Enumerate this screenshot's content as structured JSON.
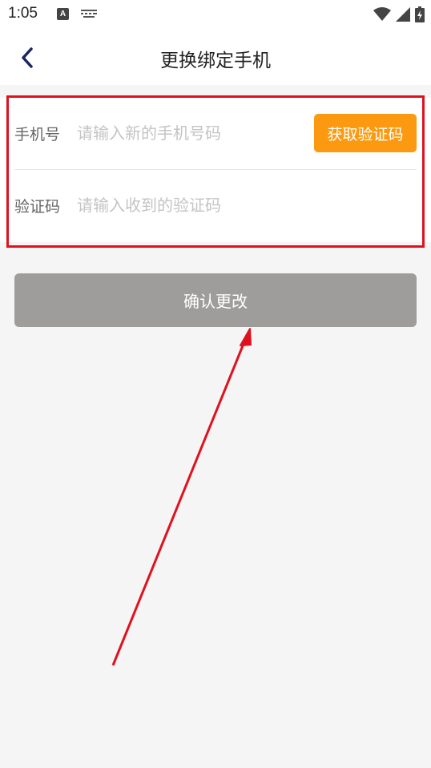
{
  "status_bar": {
    "time": "1:05",
    "a_badge": "A",
    "icons": [
      "a-notification-icon",
      "keyboard-icon",
      "wifi-icon",
      "cell-signal-icon",
      "battery-charging-icon"
    ]
  },
  "header": {
    "title": "更换绑定手机",
    "back_icon": "chevron-left-icon"
  },
  "form": {
    "phone": {
      "label": "手机号",
      "placeholder": "请输入新的手机号码",
      "value": ""
    },
    "code": {
      "label": "验证码",
      "placeholder": "请输入收到的验证码",
      "value": ""
    },
    "get_code_label": "获取验证码"
  },
  "confirm_label": "确认更改",
  "colors": {
    "accent_orange": "#fb9a10",
    "confirm_disabled": "#9e9d9c",
    "annotation_red": "#e0111f",
    "back_navy": "#1a2560",
    "background": "#f5f5f5"
  }
}
